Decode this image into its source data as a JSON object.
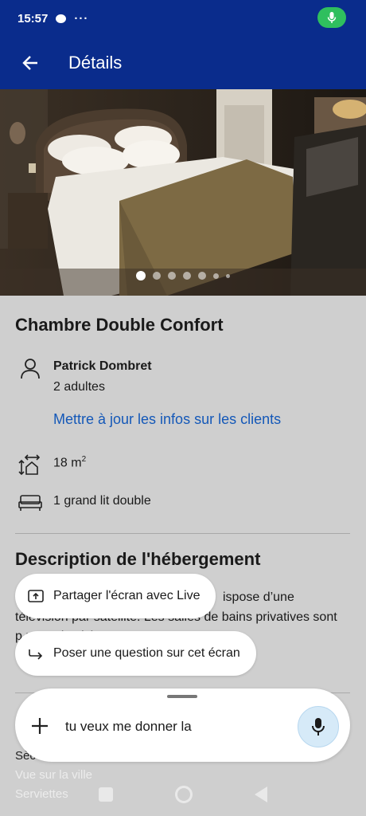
{
  "status": {
    "time": "15:57",
    "more": "···"
  },
  "app_bar": {
    "title": "Détails"
  },
  "gallery": {
    "total_images": 7,
    "current_index": 1
  },
  "room": {
    "title": "Chambre Double Confort",
    "guest_name": "Patrick Dombret",
    "guest_count": "2 adultes",
    "update_link": "Mettre à jour les infos sur les clients",
    "size": "18 m",
    "size_sup": "2",
    "bed": "1 grand lit double"
  },
  "description": {
    "title": "Description de l'hébergement",
    "line1": "ispose d’une",
    "line2": "télévision par satellite. Les salles de bains privatives sont",
    "line3": "p                                                              ux et d'articles"
  },
  "faded_items": {
    "partial1": "Sèc",
    "view": "Vue sur la ville",
    "towels": "Serviettes"
  },
  "assistant": {
    "share_chip": "Partager l'écran avec Live",
    "ask_chip": "Poser une question sur cet écran",
    "query": "tu veux me donner la"
  },
  "colors": {
    "app_bar": "#0a2c8c",
    "link": "#1458b8",
    "mic_active": "#2fbf5e",
    "mic_button_bg": "#d6eaf8"
  }
}
